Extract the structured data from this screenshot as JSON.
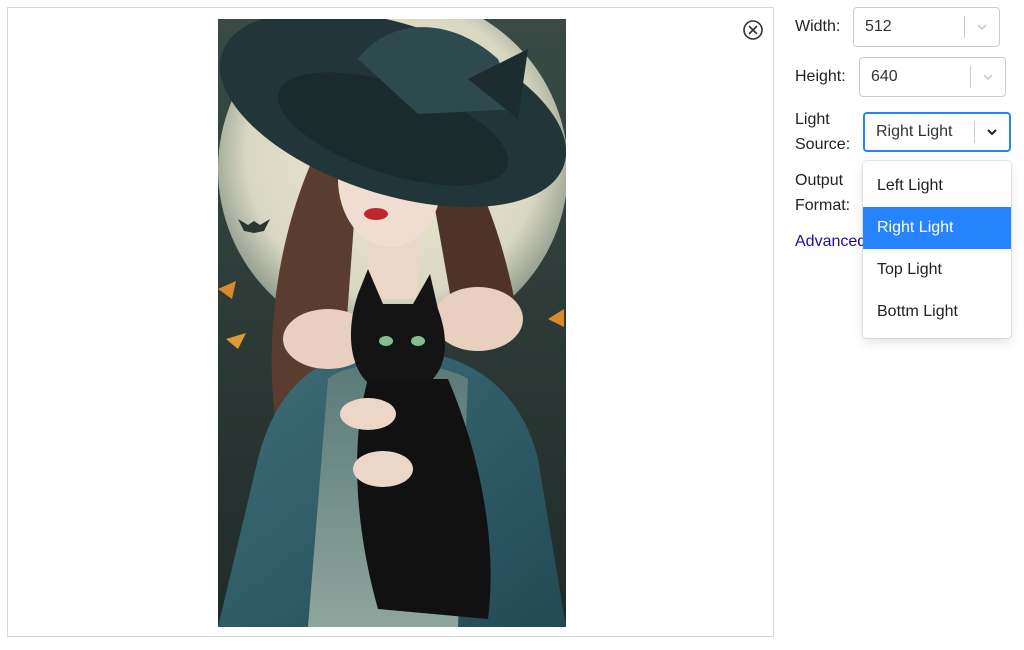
{
  "preview": {
    "image_alt": "Portrait of a woman in a witch hat holding a black cat",
    "close_icon": "close-circle-icon"
  },
  "settings": {
    "width": {
      "label": "Width:",
      "value": "512"
    },
    "height": {
      "label": "Height:",
      "value": "640"
    },
    "light_source": {
      "label_line1": "Light",
      "label_line2": "Source:",
      "value": "Right Light"
    },
    "output_format": {
      "label_line1": "Output",
      "label_line2": "Format:"
    },
    "advanced_link": "Advanced"
  },
  "dropdown": {
    "options": [
      "Left Light",
      "Right Light",
      "Top Light",
      "Bottm Light"
    ],
    "selected": "Right Light",
    "highlight_color": "#2684ff"
  },
  "colors": {
    "focus_border": "#2684ff",
    "link": "#1a0dab"
  }
}
